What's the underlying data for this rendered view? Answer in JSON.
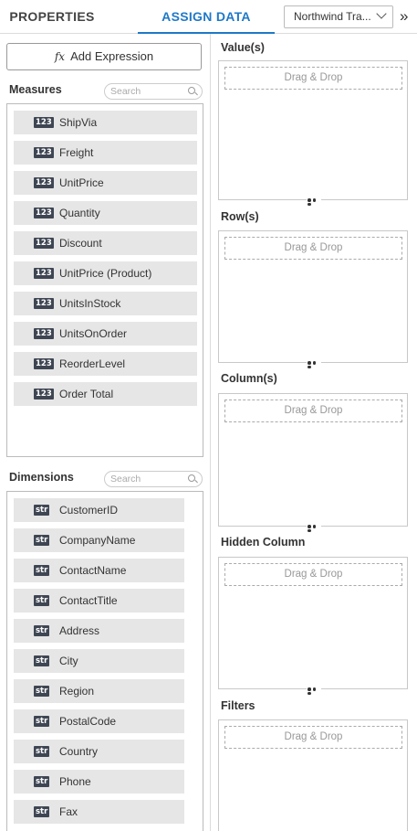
{
  "tabs": {
    "properties": "PROPERTIES",
    "assign_data": "ASSIGN DATA"
  },
  "datasource": {
    "selected": "Northwind Tra..."
  },
  "collapse_icon": "double-chevron-right-icon",
  "add_expression": {
    "icon": "fx",
    "label": "Add Expression"
  },
  "measures": {
    "title": "Measures",
    "search_placeholder": "Search",
    "type_badge": "123",
    "items": [
      "ShipVia",
      "Freight",
      "UnitPrice",
      "Quantity",
      "Discount",
      "UnitPrice (Product)",
      "UnitsInStock",
      "UnitsOnOrder",
      "ReorderLevel",
      "Order Total"
    ]
  },
  "dimensions": {
    "title": "Dimensions",
    "search_placeholder": "Search",
    "type_badge": "str",
    "items": [
      "CustomerID",
      "CompanyName",
      "ContactName",
      "ContactTitle",
      "Address",
      "City",
      "Region",
      "PostalCode",
      "Country",
      "Phone",
      "Fax"
    ]
  },
  "zones": [
    {
      "title": "Value(s)",
      "placeholder": "Drag & Drop"
    },
    {
      "title": "Row(s)",
      "placeholder": "Drag & Drop"
    },
    {
      "title": "Column(s)",
      "placeholder": "Drag & Drop"
    },
    {
      "title": "Hidden Column",
      "placeholder": "Drag & Drop"
    },
    {
      "title": "Filters",
      "placeholder": "Drag & Drop"
    }
  ],
  "colors": {
    "accent": "#1f78c8",
    "badge_bg": "#3f4653",
    "item_bg": "#e6e6e6"
  }
}
